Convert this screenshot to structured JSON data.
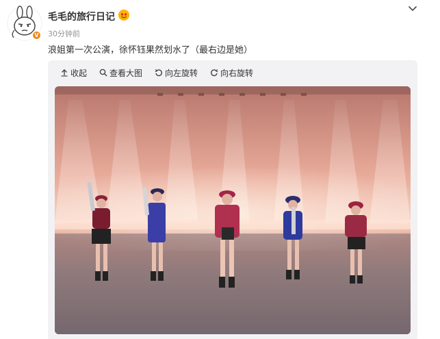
{
  "post": {
    "username": "毛毛的旅行日记",
    "verified_badge": "V",
    "timestamp": "30分钟前",
    "text": "浪姐第一次公演，徐怀钰果然划水了（最右边是她）"
  },
  "toolbar": {
    "collapse": "收起",
    "view_large": "查看大图",
    "rotate_left": "向左旋转",
    "rotate_right": "向右旋转"
  },
  "photo": {
    "scene": "five performers on stage with pink light beams",
    "performer_count": 5
  },
  "colors": {
    "accent": "#f08a1c",
    "text": "#333333",
    "muted": "#939393",
    "card_bg": "#f2f2f5"
  },
  "icons": [
    "avatar-cartoon-icon",
    "verified-icon",
    "vip-icon",
    "chevron-down-icon",
    "arrow-up-icon",
    "search-icon",
    "rotate-left-icon",
    "rotate-right-icon"
  ]
}
